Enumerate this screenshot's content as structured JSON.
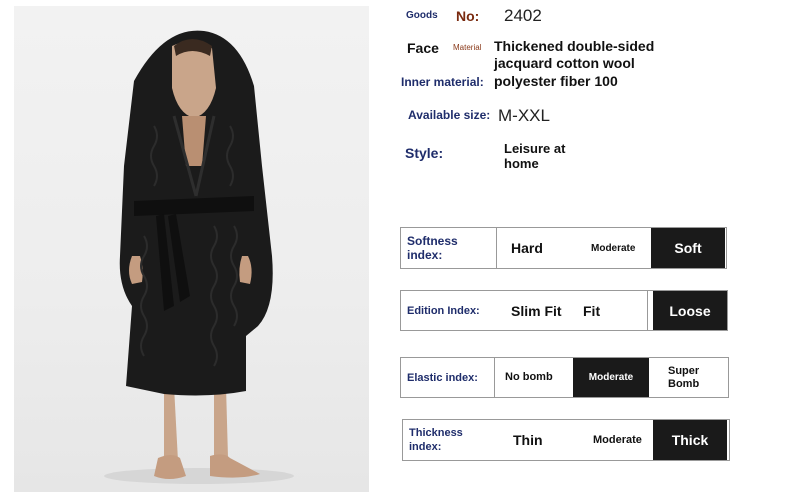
{
  "product_photo": {
    "alt": "Man wearing black hooded cable-knit fleece bathrobe"
  },
  "goods_label": "Goods",
  "no_label": "No:",
  "no_value": "2402",
  "face_label": "Face",
  "material_label": "Material",
  "face_value_line1": "Thickened double-sided",
  "face_value_line2": "jacquard cotton wool",
  "inner_label": "Inner material:",
  "inner_value": "polyester fiber 100",
  "size_label": "Available size:",
  "size_value": "M-XXL",
  "style_label": "Style:",
  "style_value": "Leisure at home",
  "ratings": [
    {
      "label": "Softness index:",
      "options": [
        "Hard",
        "Moderate",
        "Soft"
      ],
      "selected": "Soft"
    },
    {
      "label": "Edition Index:",
      "options": [
        "Slim Fit",
        "Fit",
        "Loose"
      ],
      "selected": "Loose"
    },
    {
      "label": "Elastic index:",
      "options": [
        "No bomb",
        "Moderate",
        "Super Bomb"
      ],
      "selected": "Moderate"
    },
    {
      "label": "Thickness index:",
      "options": [
        "Thin",
        "Moderate",
        "Thick"
      ],
      "selected": "Thick"
    }
  ],
  "colors": {
    "robe": "#1b1b1b",
    "selected_bg": "#1a1a1a",
    "label_blue": "#1f2d6b",
    "label_brown": "#7a2b10"
  }
}
